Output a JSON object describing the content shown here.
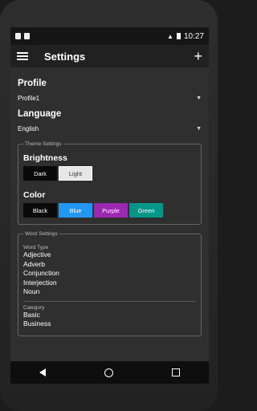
{
  "status": {
    "time": "10:27"
  },
  "toolbar": {
    "title": "Settings",
    "add": "+"
  },
  "profile": {
    "header": "Profile",
    "value": "Profile1"
  },
  "language": {
    "header": "Language",
    "value": "English"
  },
  "theme": {
    "legend": "Theme Settings",
    "brightness_label": "Brightness",
    "brightness_options": [
      "Dark",
      "Light"
    ],
    "color_label": "Color",
    "color_options": [
      "Black",
      "Blue",
      "Purple",
      "Green"
    ],
    "colors": {
      "black": "#0a0a0a",
      "blue": "#2196f3",
      "purple": "#9c27b0",
      "green": "#009688",
      "light": "#e6e6e6"
    }
  },
  "word": {
    "legend": "Word Settings",
    "type_label": "Word Type",
    "types": [
      "Adjective",
      "Adverb",
      "Conjunction",
      "Interjection",
      "Noun"
    ],
    "category_label": "Category",
    "categories": [
      "Basic",
      "Business"
    ]
  }
}
